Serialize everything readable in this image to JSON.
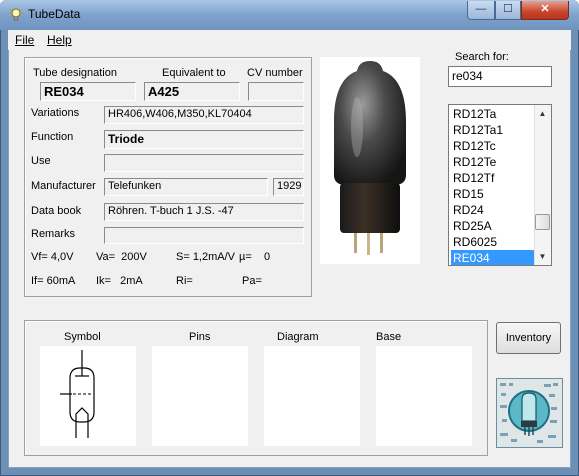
{
  "window": {
    "title": "TubeData",
    "minimize_glyph": "—",
    "maximize_glyph": "☐",
    "close_glyph": "✕"
  },
  "menu": {
    "file": "File",
    "help": "Help"
  },
  "details": {
    "tube_designation_label": "Tube designation",
    "tube_designation": "RE034",
    "equivalent_label": "Equivalent to",
    "equivalent": "A425",
    "cv_label": "CV number",
    "cv_number": "",
    "variations_label": "Variations",
    "variations": "HR406,W406,M350,KL70404",
    "function_label": "Function",
    "function": "Triode",
    "use_label": "Use",
    "use": "",
    "manufacturer_label": "Manufacturer",
    "manufacturer": "Telefunken",
    "year": "1929",
    "databook_label": "Data book",
    "databook": "Röhren. T-buch 1 J.S. -47",
    "remarks_label": "Remarks",
    "remarks": "",
    "params": {
      "vf": "Vf= 4,0V",
      "va": "Va=  200V",
      "s": "S= 1,2mA/V",
      "mu": "µ=    0",
      "if": "If= 60mA",
      "ik": "Ik=   2mA",
      "ri": "Ri=",
      "pa": "Pa="
    }
  },
  "search": {
    "label": "Search for:",
    "value": "re034",
    "results": [
      "RD12Ta",
      "RD12Ta1",
      "RD12Tc",
      "RD12Te",
      "RD12Tf",
      "RD15",
      "RD24",
      "RD25A",
      "RD6025",
      "RE034"
    ],
    "selected": "RE034"
  },
  "diagrams": {
    "symbol": "Symbol",
    "pins": "Pins",
    "diagram": "Diagram",
    "base": "Base"
  },
  "buttons": {
    "inventory": "Inventory"
  },
  "colors": {
    "titlebar": "#7fa3cc",
    "selection": "#3399ff",
    "close": "#c8452c"
  },
  "icons": {
    "app": "lightbulb-icon",
    "logo": "tube-logo-icon",
    "photo": "tube-photo"
  }
}
